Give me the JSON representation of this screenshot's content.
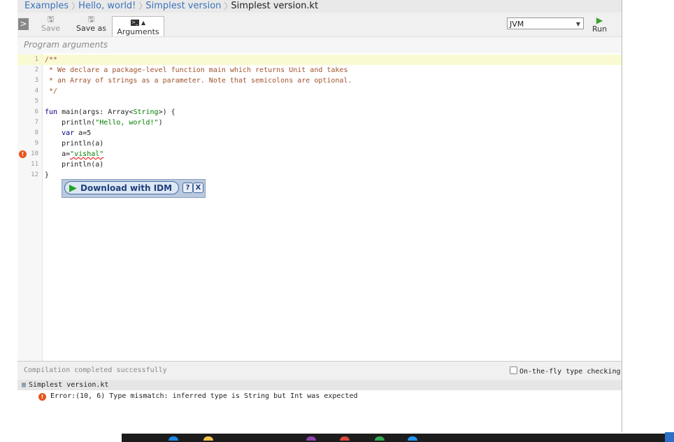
{
  "breadcrumb": [
    "Examples",
    "Hello, world!",
    "Simplest version",
    "Simplest version.kt"
  ],
  "toolbar": {
    "toggle_label": ">",
    "save_label": "Save",
    "save_as_label": "Save as",
    "arguments_label": "Arguments",
    "platform_value": "JVM",
    "run_label": "Run"
  },
  "args_placeholder": "Program arguments",
  "code_lines": [
    {
      "n": "1",
      "html": "<span class='cm'>/**</span>"
    },
    {
      "n": "2",
      "html": "<span class='cm'> * We declare a package-level function main which returns Unit and takes</span>"
    },
    {
      "n": "3",
      "html": "<span class='cm'> * an Array of strings as a parameter. Note that semicolons are optional.</span>"
    },
    {
      "n": "4",
      "html": "<span class='cm'> */</span>"
    },
    {
      "n": "5",
      "html": ""
    },
    {
      "n": "6",
      "html": "<span class='kw'>fun</span> main(args: Array&lt;<span class='str'>String</span>&gt;) {"
    },
    {
      "n": "7",
      "html": "    println(<span class='str'>\"Hello, world!\"</span>)"
    },
    {
      "n": "8",
      "html": "    <span class='kw'>var</span> a=5"
    },
    {
      "n": "9",
      "html": "    println(a)"
    },
    {
      "n": "10",
      "html": "    a=<span class='str err'>\"vishal\"</span>"
    },
    {
      "n": "11",
      "html": "    println(a)"
    },
    {
      "n": "12",
      "html": "}"
    }
  ],
  "error_line": "10",
  "idm": {
    "label": "Download with IDM",
    "help": "?",
    "close": "X"
  },
  "status": {
    "text": "Compilation completed successfully",
    "onfly_label": "On-the-fly type checking"
  },
  "console": {
    "file": "Simplest version.kt",
    "error": "Error:(10, 6) Type mismatch: inferred type is String but Int was expected"
  },
  "colors": {
    "error": "#e8541c",
    "run": "#3aa12d",
    "link": "#3b73b9",
    "active_line": "#fafad2"
  }
}
